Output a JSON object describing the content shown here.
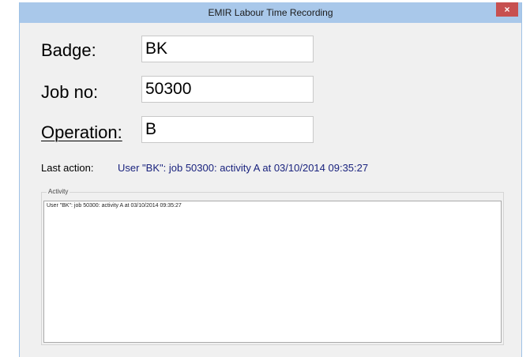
{
  "window": {
    "title": "EMIR Labour Time Recording",
    "close_label": "×"
  },
  "form": {
    "badge": {
      "label": "Badge:",
      "value": "BK"
    },
    "job": {
      "label": "Job no:",
      "value": "50300"
    },
    "operation": {
      "label": "Operation:",
      "value": "B"
    }
  },
  "status": {
    "last_action_label": "Last action:",
    "last_action_value": "User \"BK\": job 50300: activity A at 03/10/2014 09:35:27"
  },
  "activity": {
    "legend": "Activity",
    "log_text": "User \"BK\": job 50300: activity A at 03/10/2014 09:35:27"
  }
}
